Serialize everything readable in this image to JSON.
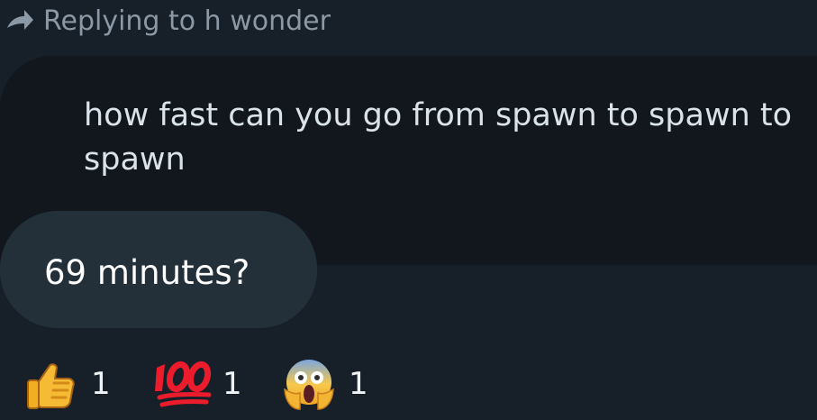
{
  "reply_context": {
    "label": "Replying to h wonder",
    "icon": "reply-arrow-icon"
  },
  "quoted_message": {
    "text": "how fast can you go from spawn to spawn to spawn"
  },
  "reply_message": {
    "text": "69 minutes?"
  },
  "reactions": [
    {
      "icon": "thumbs-up-emoji",
      "count": "1"
    },
    {
      "icon": "hundred-points-emoji",
      "count": "1"
    },
    {
      "icon": "screaming-face-emoji",
      "count": "1"
    }
  ],
  "colors": {
    "background": "#172029",
    "quoted_bubble": "#11171c",
    "reply_bubble": "#243039",
    "secondary_text": "#8b98a5"
  }
}
